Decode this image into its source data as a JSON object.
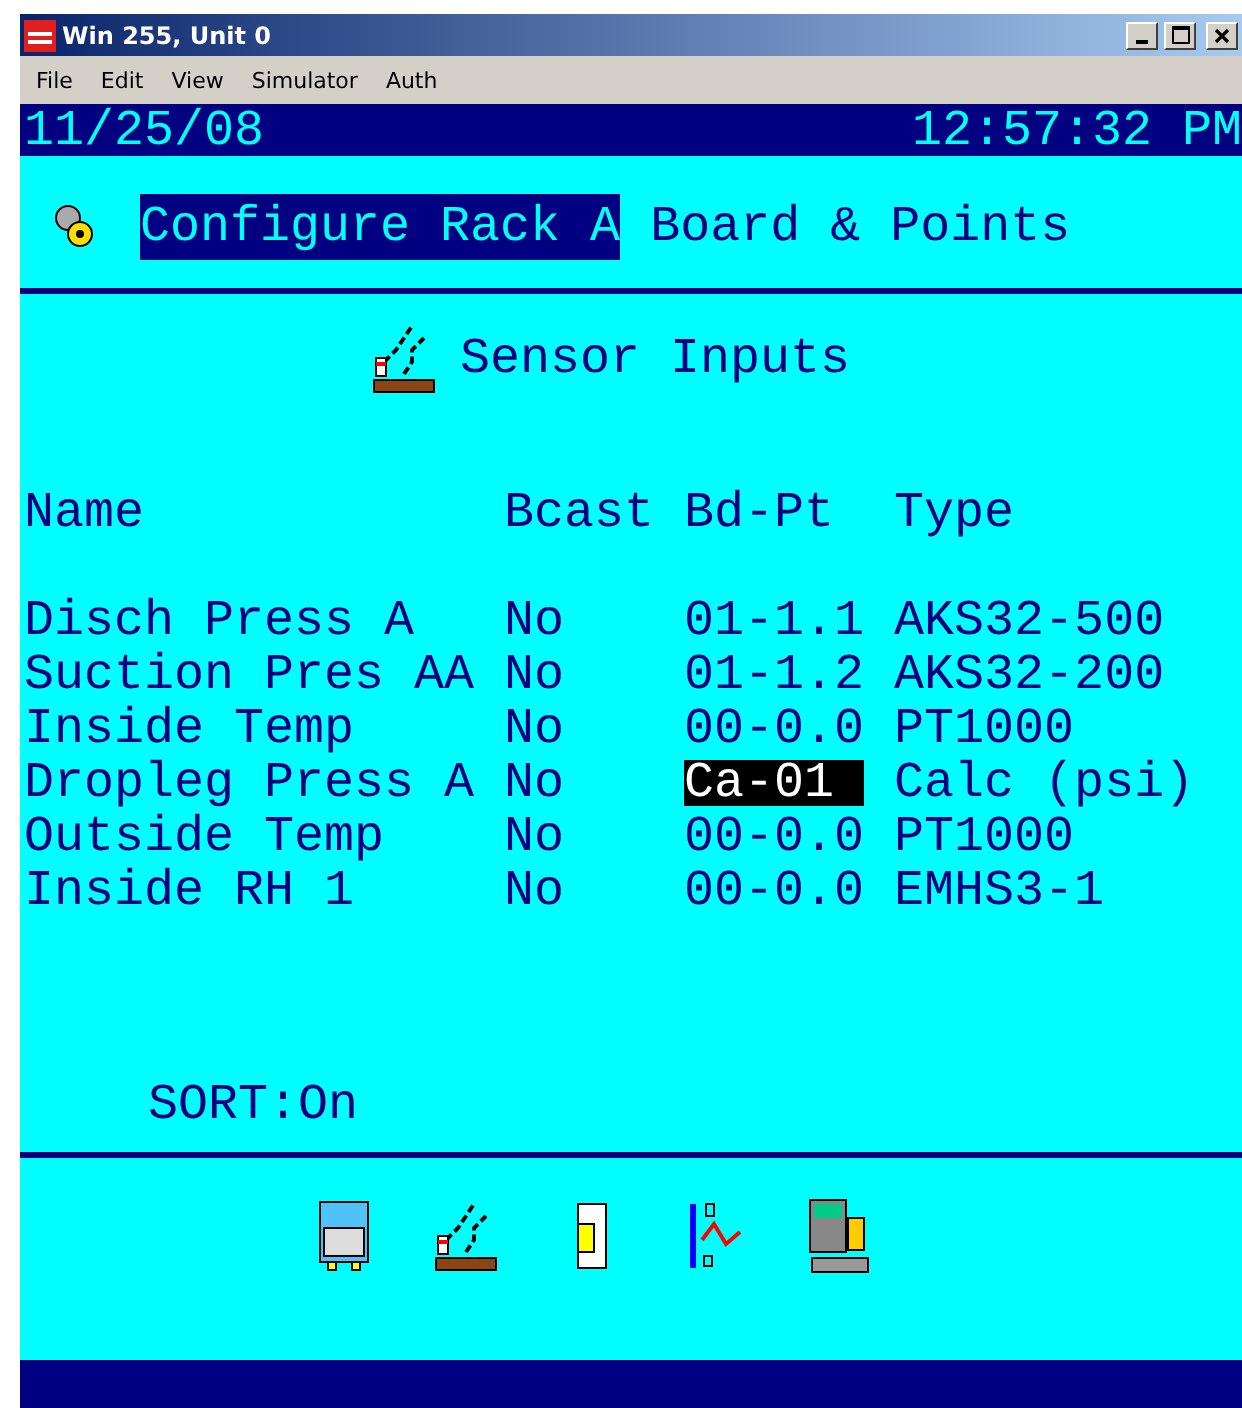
{
  "window": {
    "title": "Win 255, Unit 0"
  },
  "menu": [
    "File",
    "Edit",
    "View",
    "Simulator",
    "Auth"
  ],
  "status": {
    "date": "11/25/08",
    "time": "12:57:32 PM"
  },
  "heading": {
    "highlighted": "Configure Rack A",
    "rest": "Board & Points"
  },
  "section": {
    "title": "Sensor Inputs"
  },
  "columns": [
    "Name",
    "Bcast",
    "Bd-Pt",
    "Type"
  ],
  "rows": [
    {
      "name": "Disch Press A",
      "bcast": "No",
      "bd_pt": "01-1.1",
      "type": "AKS32-500",
      "cursor": false
    },
    {
      "name": "Suction Pres AA",
      "bcast": "No",
      "bd_pt": "01-1.2",
      "type": "AKS32-200",
      "cursor": false
    },
    {
      "name": "Inside Temp",
      "bcast": "No",
      "bd_pt": "00-0.0",
      "type": "PT1000",
      "cursor": false
    },
    {
      "name": "Dropleg Press A",
      "bcast": "No",
      "bd_pt": "Ca-01",
      "type": "Calc (psi)",
      "cursor": true
    },
    {
      "name": "Outside Temp",
      "bcast": "No",
      "bd_pt": "00-0.0",
      "type": "PT1000",
      "cursor": false
    },
    {
      "name": "Inside RH 1",
      "bcast": "No",
      "bd_pt": "00-0.0",
      "type": "EMHS3-1",
      "cursor": false
    }
  ],
  "sort": "SORT:On",
  "toolbar": [
    {
      "kind": "unit"
    },
    {
      "kind": "sensor"
    },
    {
      "kind": "relay"
    },
    {
      "kind": "graph"
    },
    {
      "kind": "controller"
    }
  ]
}
